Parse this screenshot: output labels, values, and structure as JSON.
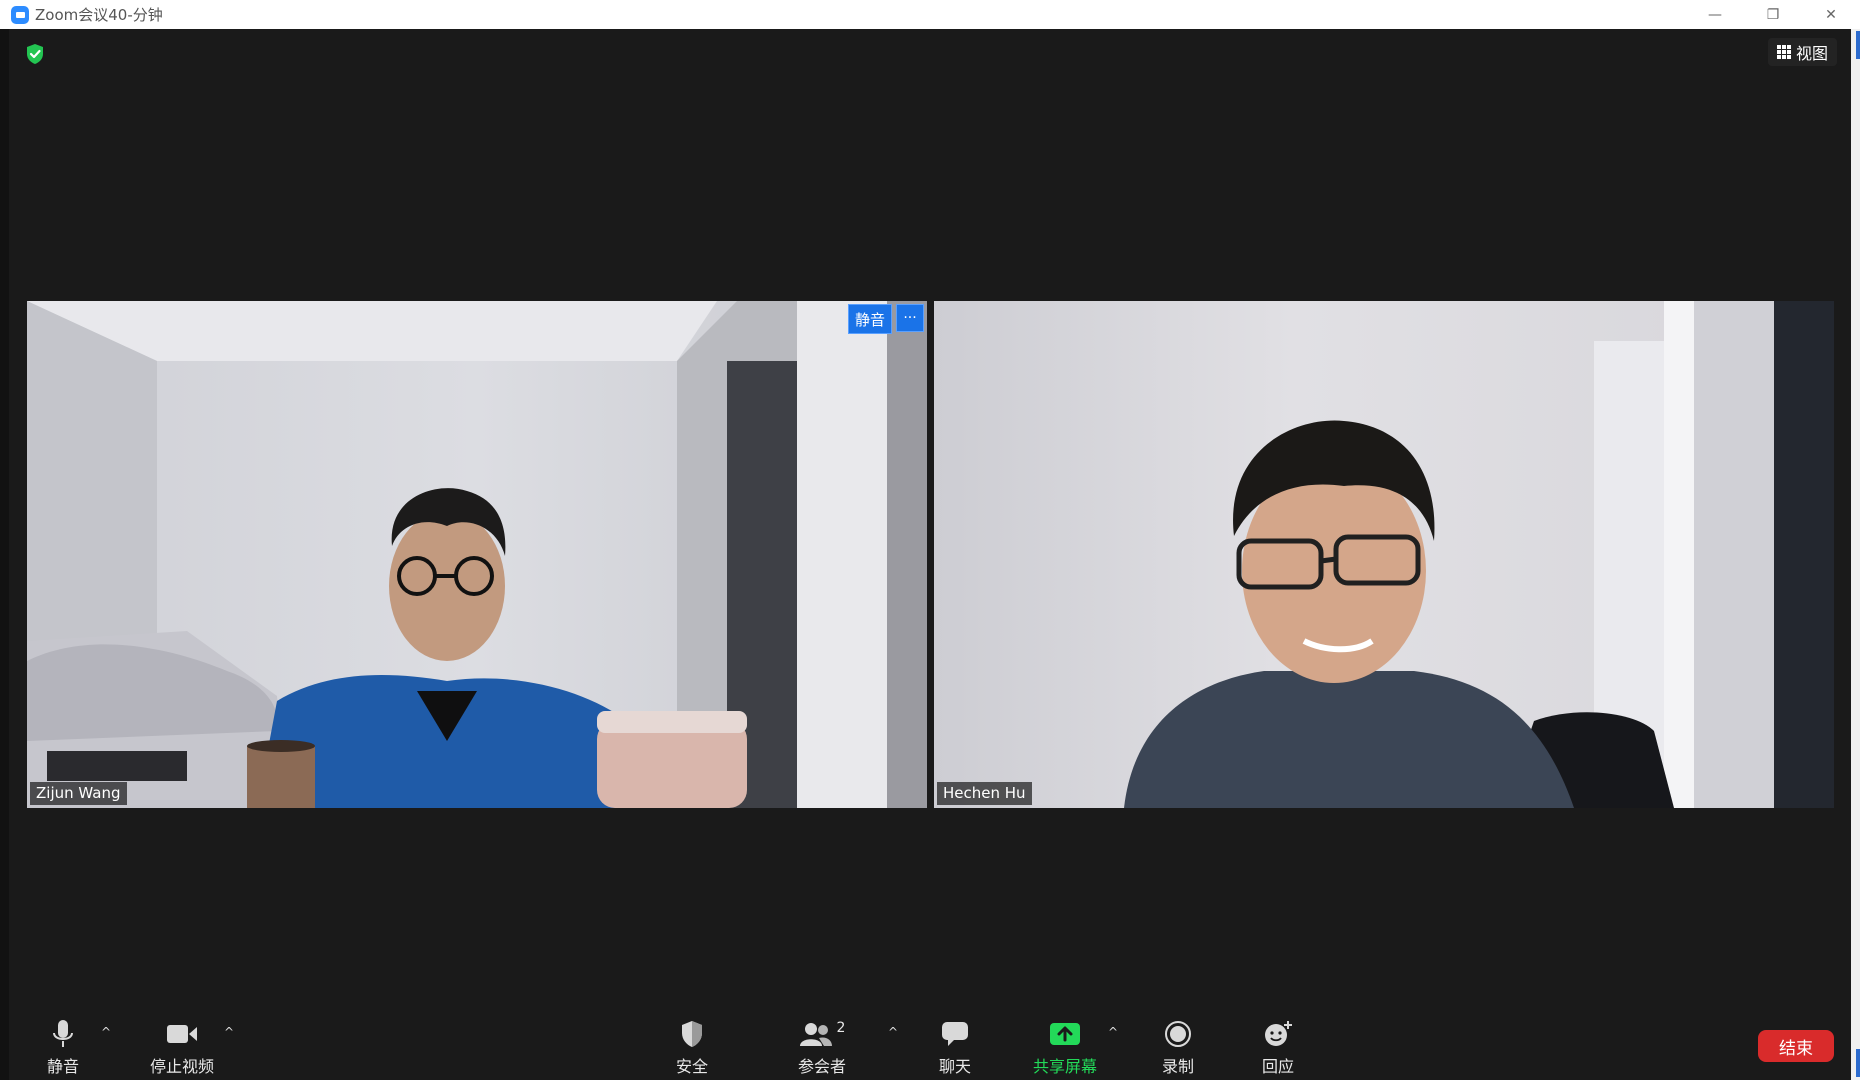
{
  "window": {
    "title": "Zoom会议40-分钟",
    "minimize": "—",
    "restore": "❐",
    "close": "✕"
  },
  "header": {
    "view_label": "视图"
  },
  "participants": [
    {
      "name": "Zijun Wang",
      "mute_label": "静音",
      "more_label": "···"
    },
    {
      "name": "Hechen Hu"
    }
  ],
  "toolbar": {
    "mute_label": "静音",
    "stop_video_label": "停止视频",
    "security_label": "安全",
    "participants_label": "参会者",
    "participants_count": "2",
    "chat_label": "聊天",
    "share_screen_label": "共享屏幕",
    "record_label": "录制",
    "reactions_label": "回应",
    "end_label": "结束",
    "caret": "^"
  },
  "colors": {
    "share_green": "#23d959",
    "end_red": "#d92b2b",
    "accent_blue": "#1a73e8",
    "background": "#1a1a1a"
  },
  "icons": [
    "security-shield-icon",
    "grid-view-icon",
    "microphone-icon",
    "video-camera-icon",
    "shield-icon",
    "participants-icon",
    "chat-bubble-icon",
    "share-screen-icon",
    "record-icon",
    "reaction-icon"
  ]
}
